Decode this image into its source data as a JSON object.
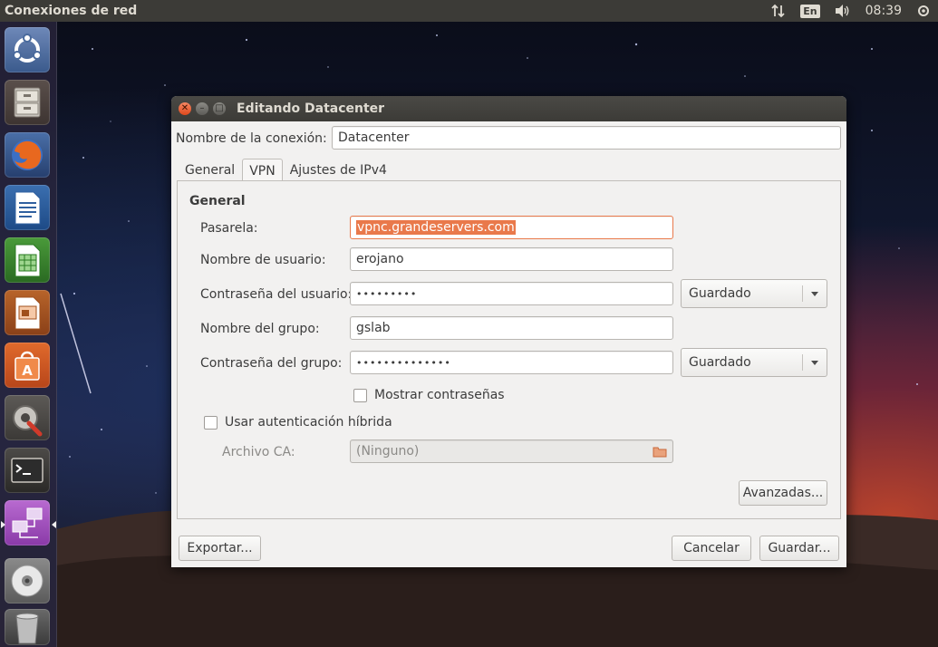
{
  "panel": {
    "title": "Conexiones de red",
    "language": "En",
    "clock": "08:39"
  },
  "launcher": {
    "items": [
      {
        "name": "ubuntu-dash",
        "icon": "ubuntu-logo-icon"
      },
      {
        "name": "files",
        "icon": "file-cabinet-icon"
      },
      {
        "name": "firefox",
        "icon": "firefox-icon"
      },
      {
        "name": "writer",
        "icon": "libreoffice-writer-icon"
      },
      {
        "name": "calc",
        "icon": "libreoffice-calc-icon"
      },
      {
        "name": "impress",
        "icon": "libreoffice-impress-icon"
      },
      {
        "name": "software-center",
        "icon": "shopping-bag-icon"
      },
      {
        "name": "system-settings",
        "icon": "gear-wrench-icon"
      },
      {
        "name": "terminal",
        "icon": "terminal-icon"
      },
      {
        "name": "network-connections",
        "icon": "network-icon"
      },
      {
        "name": "disc",
        "icon": "cd-icon"
      },
      {
        "name": "trash",
        "icon": "trash-icon"
      }
    ]
  },
  "dialog": {
    "title": "Editando Datacenter",
    "connection_name_label": "Nombre de la conexión:",
    "connection_name_value": "Datacenter",
    "tabs": [
      {
        "label": "General",
        "active": false
      },
      {
        "label": "VPN",
        "active": true
      },
      {
        "label": "Ajustes de IPv4",
        "active": false
      }
    ],
    "vpn": {
      "section_title": "General",
      "gateway_label": "Pasarela:",
      "gateway_value": "vpnc.grandeservers.com",
      "username_label": "Nombre de usuario:",
      "username_value": "erojano",
      "user_password_label": "Contraseña del usuario:",
      "user_password_value": "•••••••••",
      "user_password_mode": "Guardado",
      "group_name_label": "Nombre del grupo:",
      "group_name_value": "gslab",
      "group_password_label": "Contraseña del grupo:",
      "group_password_value": "••••••••••••••",
      "group_password_mode": "Guardado",
      "show_passwords_label": "Mostrar contraseñas",
      "hybrid_auth_label": "Usar autenticación híbrida",
      "ca_file_label": "Archivo CA:",
      "ca_file_value": "(Ninguno)",
      "advanced_label": "Avanzadas..."
    },
    "buttons": {
      "export": "Exportar...",
      "cancel": "Cancelar",
      "save": "Guardar..."
    }
  },
  "colors": {
    "panel_bg": "#3c3b37",
    "accent": "#e9794b",
    "close_button": "#e0491c"
  }
}
